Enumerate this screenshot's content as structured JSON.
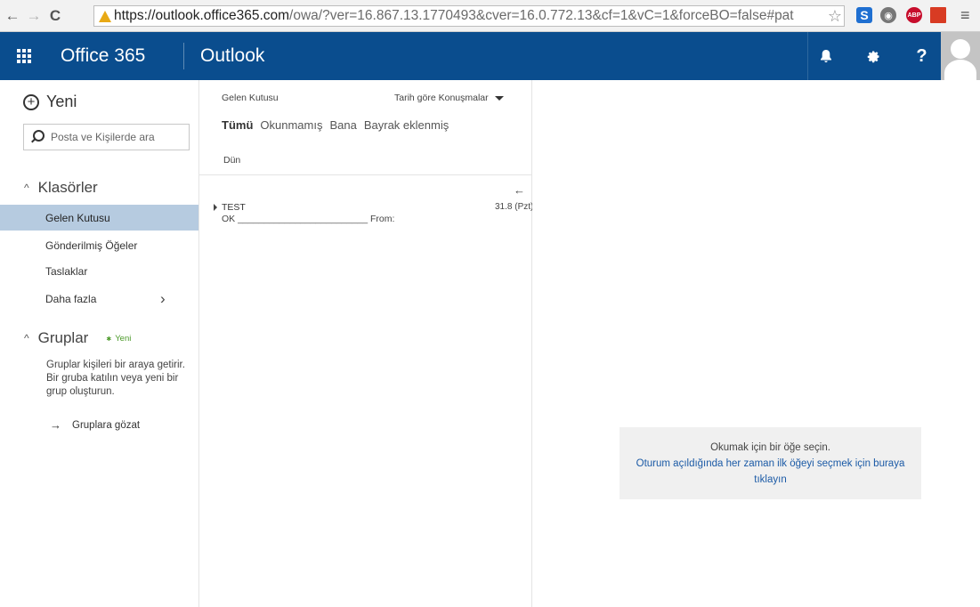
{
  "browser": {
    "url_host": "https://outlook.office365.com",
    "url_rest": "/owa/?ver=16.867.13.1770493&cver=16.0.772.13&cf=1&vC=1&forceBO=false#pat",
    "extensions": [
      "S",
      "ABP"
    ]
  },
  "header": {
    "brand": "Office 365",
    "app_name": "Outlook",
    "icons": [
      "bell-icon",
      "gear-icon",
      "help-icon"
    ],
    "help_label": "?",
    "bg_color": "#0a4d8e"
  },
  "leftnav": {
    "new_label": "Yeni",
    "search_placeholder": "Posta ve Kişilerde ara",
    "folders_title": "Klasörler",
    "folders": [
      {
        "label": "Gelen Kutusu",
        "selected": true
      },
      {
        "label": "Gönderilmiş Öğeler",
        "selected": false
      },
      {
        "label": "Taslaklar",
        "selected": false
      },
      {
        "label": "Daha fazla",
        "selected": false
      }
    ],
    "groups_title": "Gruplar",
    "groups_badge": "Yeni",
    "groups_description": "Gruplar kişileri bir araya getirir. Bir gruba katılın veya yeni bir grup oluşturun.",
    "groups_browse": "Gruplara gözat"
  },
  "message_list": {
    "title": "Gelen Kutusu",
    "sort_label": "Tarih göre Konuşmalar",
    "filters": [
      "Tümü",
      "Okunmamış",
      "Bana",
      "Bayrak eklenmiş"
    ],
    "active_filter": "Tümü",
    "group_header": "Dün",
    "messages": [
      {
        "subject": "TEST",
        "date": "31.8 (Pzt)",
        "preview": "OK _________________________ From:"
      }
    ]
  },
  "reading_pane": {
    "empty_line": "Okumak için bir öğe seçin.",
    "empty_link": "Oturum açıldığında her zaman ilk öğeyi seçmek için buraya tıklayın"
  }
}
